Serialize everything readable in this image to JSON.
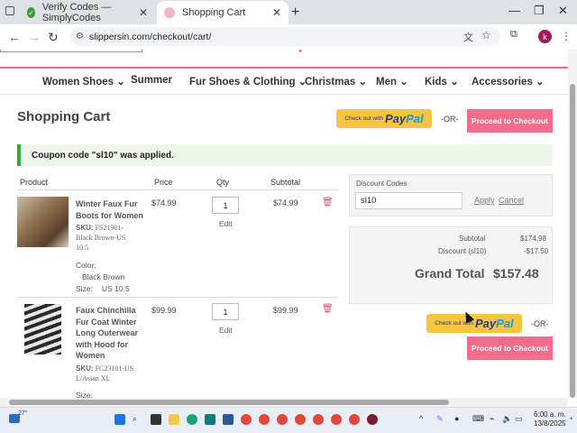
{
  "browser": {
    "tabs": [
      {
        "title": "Verify Codes — SimplyCodes",
        "active": false
      },
      {
        "title": "Shopping Cart",
        "active": true
      }
    ],
    "url": "slippersin.com/checkout/cart/",
    "profile_initial": "k"
  },
  "nav": {
    "items": [
      "Women Shoes",
      "Summer",
      "Fur Shoes & Clothing",
      "Christmas",
      "Men",
      "Kids",
      "Accessories"
    ]
  },
  "cart": {
    "title": "Shopping Cart",
    "paypal_prefix": "Check out with",
    "paypal_brand_a": "Pay",
    "paypal_brand_b": "Pal",
    "or_label": "-OR-",
    "checkout_label": "Proceed to Checkout",
    "notice": "Coupon code \"sl10\" was applied.",
    "columns": {
      "product": "Product",
      "price": "Price",
      "qty": "Qty",
      "subtotal": "Subtotal"
    },
    "items": [
      {
        "name_lines": [
          "Winter Faux Fur",
          "Boots for Women"
        ],
        "sku_label": "SKU:",
        "sku_lines": [
          "FS21901-",
          "Black Brown-US",
          "10.5"
        ],
        "color_label": "Color:",
        "color": "Black Brown",
        "size_label": "Size:",
        "size": "US 10.5",
        "price": "$74.99",
        "qty": "1",
        "edit": "Edit",
        "subtotal": "$74.99"
      },
      {
        "name_lines": [
          "Faux Chinchilla",
          "Fur Coat Winter",
          "Long Outerwear",
          "with Hood for",
          "Women"
        ],
        "sku_label": "SKU:",
        "sku_lines": [
          "FC23101-US",
          "L/Asian XL"
        ],
        "size_label": "Size:",
        "price": "$99.99",
        "qty": "1",
        "edit": "Edit",
        "subtotal": "$99.99"
      }
    ]
  },
  "discount": {
    "label": "Discount Codes",
    "code": "sl10",
    "apply": "Apply",
    "cancel": "Cancel"
  },
  "totals": {
    "subtotal_label": "Subtotal",
    "subtotal": "$174.98",
    "discount_label": "Discount (sl10)",
    "discount": "-$17.50",
    "grand_label": "Grand Total",
    "grand": "$157.48"
  },
  "taskbar": {
    "weather": "27°",
    "time": "6:00 a. m.",
    "date": "13/8/2025"
  },
  "colors": {
    "accent": "#f26c8c",
    "paypal": "#f7c542",
    "notice_border": "#3aa53a"
  }
}
